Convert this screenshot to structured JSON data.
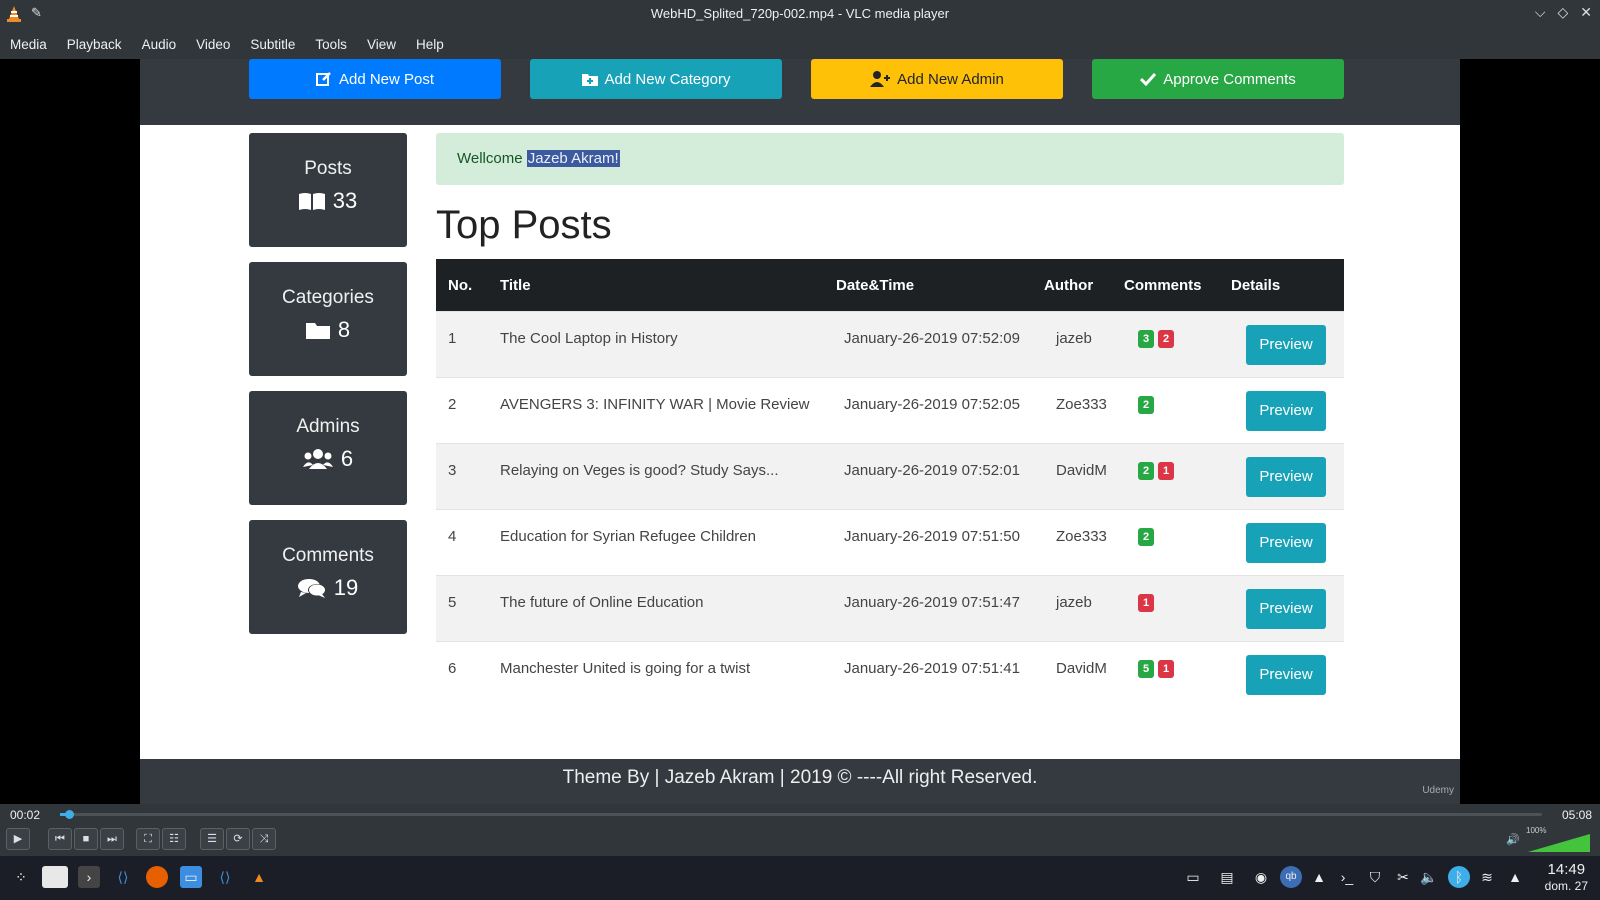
{
  "window": {
    "title": "WebHD_Splited_720p-002.mp4 - VLC media player"
  },
  "menubar": [
    "Media",
    "Playback",
    "Audio",
    "Video",
    "Subtitle",
    "Tools",
    "View",
    "Help"
  ],
  "site": {
    "actions": [
      {
        "label": "Add New Post",
        "icon": "edit-icon",
        "color": "#007bff"
      },
      {
        "label": "Add New Category",
        "icon": "folder-plus-icon",
        "color": "#17a2b8"
      },
      {
        "label": "Add New Admin",
        "icon": "user-plus-icon",
        "color": "#ffc107"
      },
      {
        "label": "Approve Comments",
        "icon": "check-icon",
        "color": "#28a745"
      }
    ],
    "stats": [
      {
        "label": "Posts",
        "value": "33",
        "icon": "book-icon"
      },
      {
        "label": "Categories",
        "value": "8",
        "icon": "folder-icon"
      },
      {
        "label": "Admins",
        "value": "6",
        "icon": "users-icon"
      },
      {
        "label": "Comments",
        "value": "19",
        "icon": "comments-icon"
      }
    ],
    "welcome": {
      "prefix": "Wellcome ",
      "name": "Jazeb Akram!"
    },
    "page_title": "Top Posts",
    "table": {
      "headers": [
        "No.",
        "Title",
        "Date&Time",
        "Author",
        "Comments",
        "Details"
      ],
      "rows": [
        {
          "no": "1",
          "title": "The Cool Laptop in History",
          "date": "January-26-2019 07:52:09",
          "author": "jazeb",
          "approved": "3",
          "pending": "2",
          "details": "Preview"
        },
        {
          "no": "2",
          "title": "AVENGERS 3: INFINITY WAR | Movie Review",
          "date": "January-26-2019 07:52:05",
          "author": "Zoe333",
          "approved": "2",
          "pending": "",
          "details": "Preview"
        },
        {
          "no": "3",
          "title": "Relaying on Veges is good? Study Says...",
          "date": "January-26-2019 07:52:01",
          "author": "DavidM",
          "approved": "2",
          "pending": "1",
          "details": "Preview"
        },
        {
          "no": "4",
          "title": "Education for Syrian Refugee Children",
          "date": "January-26-2019 07:51:50",
          "author": "Zoe333",
          "approved": "2",
          "pending": "",
          "details": "Preview"
        },
        {
          "no": "5",
          "title": "The future of Online Education",
          "date": "January-26-2019 07:51:47",
          "author": "jazeb",
          "approved": "",
          "pending": "1",
          "details": "Preview"
        },
        {
          "no": "6",
          "title": "Manchester United is going for a twist",
          "date": "January-26-2019 07:51:41",
          "author": "DavidM",
          "approved": "5",
          "pending": "1",
          "details": "Preview"
        }
      ]
    },
    "footer": "Theme By | Jazeb Akram | 2019 © ----All right Reserved.",
    "watermark": "Udemy"
  },
  "player": {
    "elapsed": "00:02",
    "total": "05:08",
    "progress_fraction": 0.006,
    "volume_label": "100%",
    "volume_fraction": 1.0,
    "accent": "#3daee9"
  },
  "taskbar": {
    "time": "14:49",
    "date": "dom. 27"
  }
}
